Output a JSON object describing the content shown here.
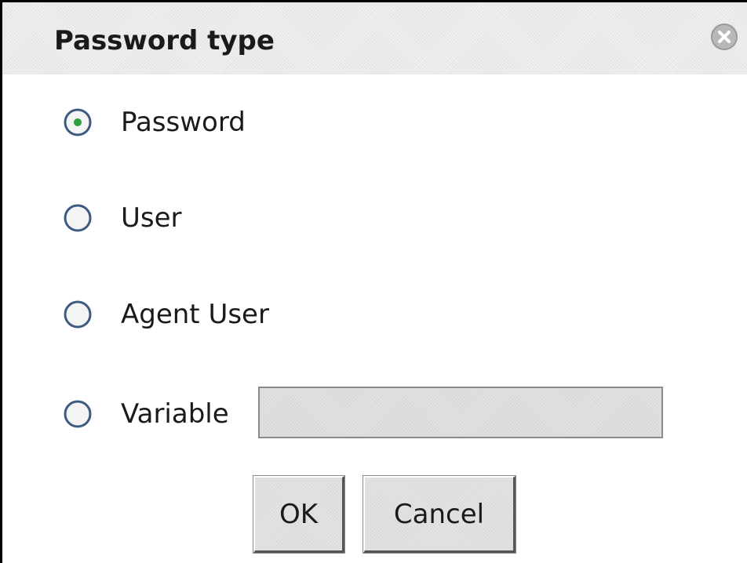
{
  "dialog": {
    "title": "Password type",
    "close_icon": "close-circle-icon"
  },
  "options": [
    {
      "label": "Password",
      "selected": true
    },
    {
      "label": "User",
      "selected": false
    },
    {
      "label": "Agent User",
      "selected": false
    },
    {
      "label": "Variable",
      "selected": false
    }
  ],
  "variable_field": {
    "value": "",
    "placeholder": "",
    "disabled": true
  },
  "buttons": {
    "ok_label": "OK",
    "cancel_label": "Cancel"
  },
  "colors": {
    "radio_ring": "#3d5a80",
    "radio_selected_dot": "#2e9e3e",
    "titlebar_bg": "#f0f0f0",
    "disabled_field_bg": "#e2e2e2"
  }
}
